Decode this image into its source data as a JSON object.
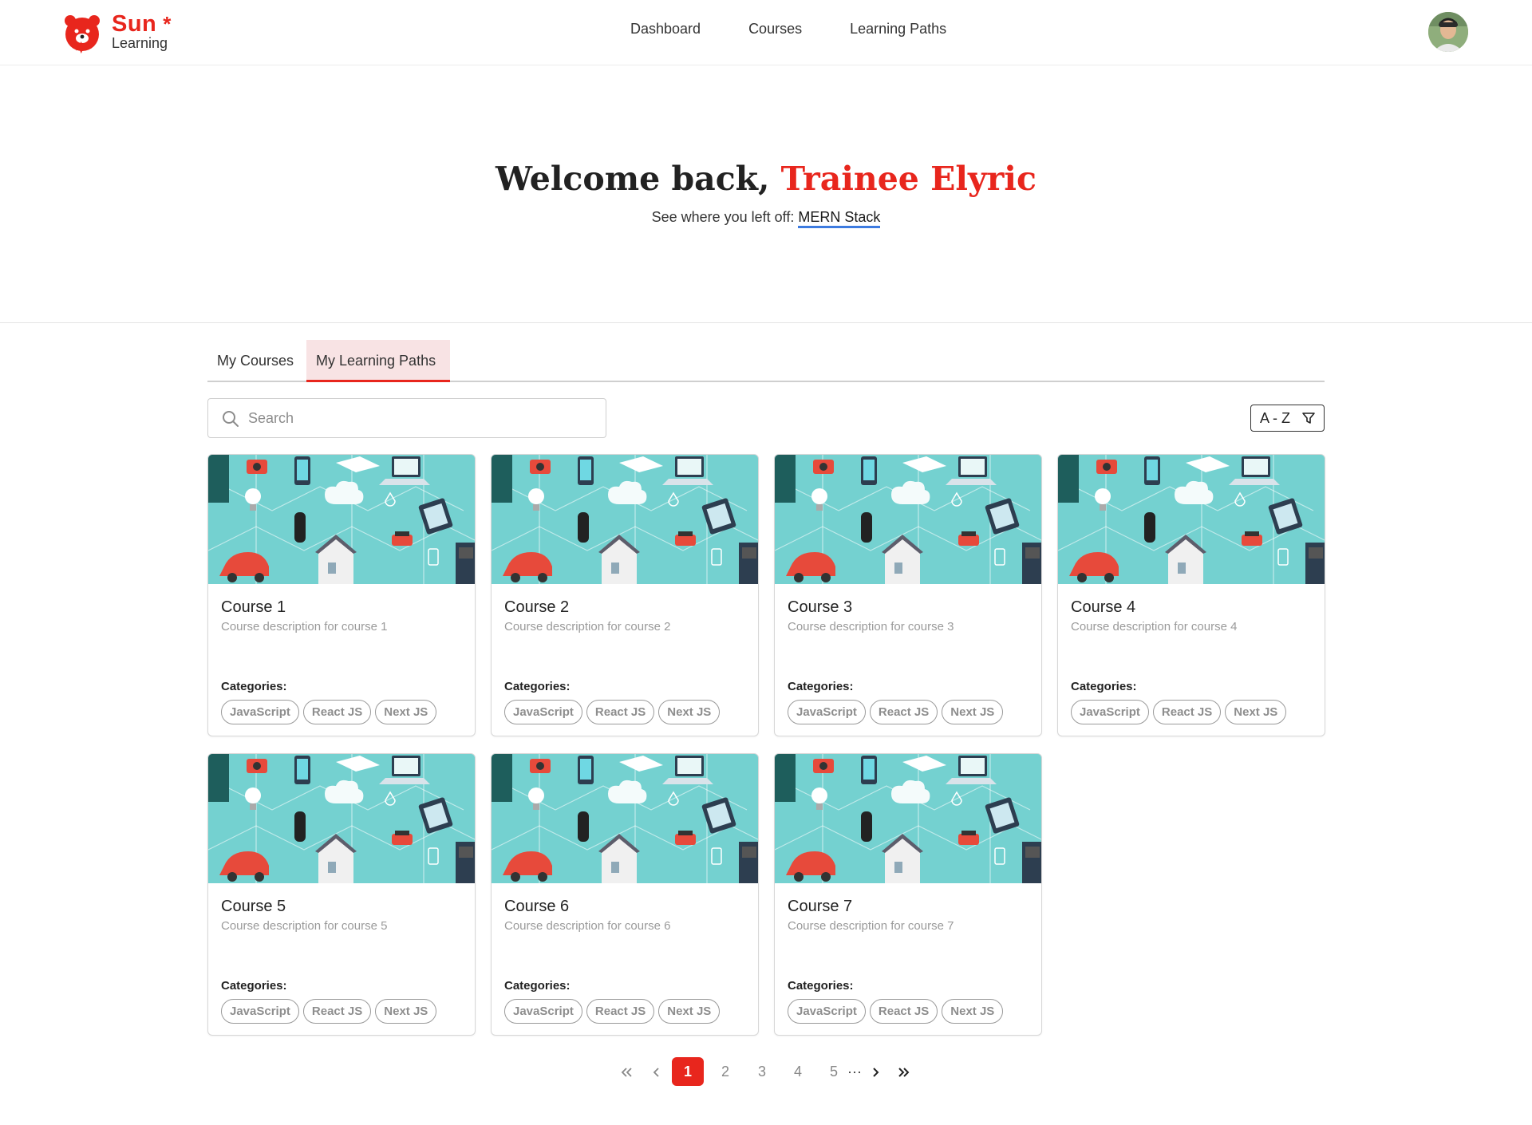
{
  "brand": {
    "name": "Sun",
    "star": "*",
    "sub": "Learning",
    "logo_icon": "bear-logo-icon",
    "accent": "#e8261d"
  },
  "nav": {
    "items": [
      "Dashboard",
      "Courses",
      "Learning Paths"
    ]
  },
  "user": {
    "avatar_icon": "user-avatar"
  },
  "hero": {
    "greeting": "Welcome back,",
    "name": "Trainee Elyric",
    "resume_text": "See where you left off:",
    "resume_link": "MERN Stack"
  },
  "tabs": [
    {
      "label": "My Courses",
      "active": false
    },
    {
      "label": "My Learning Paths",
      "active": true
    }
  ],
  "search": {
    "placeholder": "Search",
    "value": ""
  },
  "sort": {
    "label": "A - Z",
    "icon": "filter-icon"
  },
  "cards": [
    {
      "title": "Course 1",
      "description": "Course description for course 1",
      "categories_label": "Categories:",
      "tags": [
        "JavaScript",
        "React JS",
        "Next JS"
      ]
    },
    {
      "title": "Course 2",
      "description": "Course description for course 2",
      "categories_label": "Categories:",
      "tags": [
        "JavaScript",
        "React JS",
        "Next JS"
      ]
    },
    {
      "title": "Course 3",
      "description": "Course description for course 3",
      "categories_label": "Categories:",
      "tags": [
        "JavaScript",
        "React JS",
        "Next JS"
      ]
    },
    {
      "title": "Course 4",
      "description": "Course description for course 4",
      "categories_label": "Categories:",
      "tags": [
        "JavaScript",
        "React JS",
        "Next JS"
      ]
    },
    {
      "title": "Course 5",
      "description": "Course description for course 5",
      "categories_label": "Categories:",
      "tags": [
        "JavaScript",
        "React JS",
        "Next JS"
      ]
    },
    {
      "title": "Course 6",
      "description": "Course description for course 6",
      "categories_label": "Categories:",
      "tags": [
        "JavaScript",
        "React JS",
        "Next JS"
      ]
    },
    {
      "title": "Course 7",
      "description": "Course description for course 7",
      "categories_label": "Categories:",
      "tags": [
        "JavaScript",
        "React JS",
        "Next JS"
      ]
    }
  ],
  "pagination": {
    "pages": [
      "1",
      "2",
      "3",
      "4",
      "5"
    ],
    "current": "1",
    "ellipsis": "···"
  }
}
